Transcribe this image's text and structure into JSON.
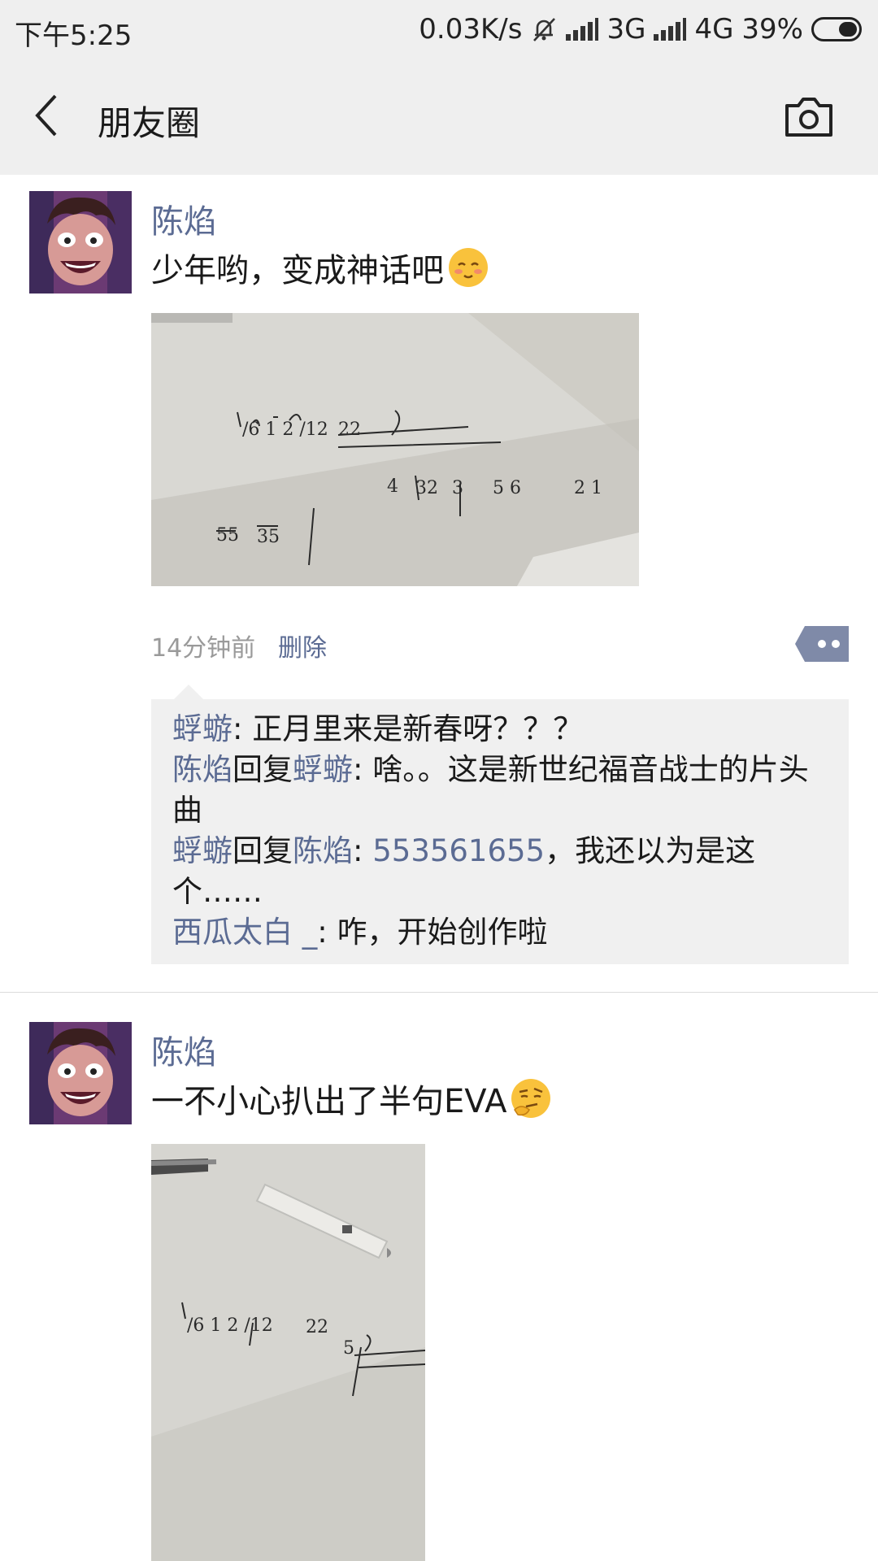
{
  "status_bar": {
    "time": "下午5:25",
    "net_speed": "0.03K/s",
    "net1": "3G",
    "net2": "4G",
    "battery": "39%"
  },
  "nav": {
    "title": "朋友圈",
    "back_icon": "back-arrow-icon",
    "camera_icon": "camera-icon"
  },
  "colors": {
    "link": "#5b6b93",
    "comment_bg": "#f0f0f0",
    "header_bg": "#efefef"
  },
  "posts": [
    {
      "author": "陈焰",
      "text": "少年哟，变成神话吧",
      "emoji": "smile-blush-emoji",
      "time": "14分钟前",
      "delete_label": "删除",
      "comments": [
        {
          "from": "蜉蝣",
          "sep": ": ",
          "text": "正月里来是新春呀？？？"
        },
        {
          "from": "陈焰",
          "reply_word": "回复",
          "to": "蜉蝣",
          "sep": ": ",
          "text": "啥。。这是新世纪福音战士的片头曲"
        },
        {
          "from": "蜉蝣",
          "reply_word": "回复",
          "to": "陈焰",
          "sep": ": ",
          "number": "553561655",
          "text": "，我还以为是这个……"
        },
        {
          "from": "西瓜太白 _",
          "sep": ": ",
          "text": "咋，开始创作啦"
        }
      ]
    },
    {
      "author": "陈焰",
      "text": "一不小心扒出了半句EVA",
      "emoji": "thinking-smirk-emoji"
    }
  ]
}
